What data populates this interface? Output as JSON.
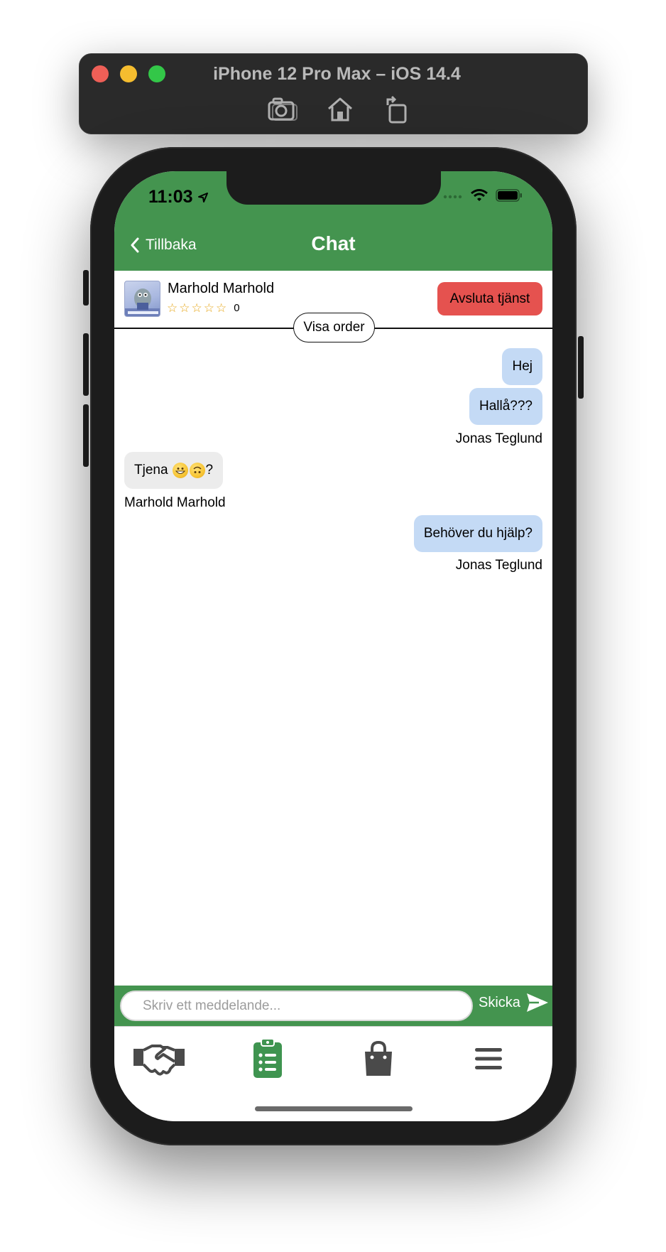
{
  "simulator": {
    "title": "iPhone 12 Pro Max – iOS 14.4",
    "tools": [
      "screenshot-icon",
      "home-icon",
      "rotate-icon"
    ]
  },
  "status_bar": {
    "time": "11:03"
  },
  "nav": {
    "back_label": "Tillbaka",
    "title": "Chat"
  },
  "user": {
    "name": "Marhold Marhold",
    "rating_stars": 0,
    "rating_count": "0",
    "end_service_label": "Avsluta tjänst",
    "view_order_label": "Visa order"
  },
  "messages": [
    {
      "text": "Hej",
      "from": "me"
    },
    {
      "text": "Hallå???",
      "from": "me",
      "sender": "Jonas Teglund"
    },
    {
      "text": "Tjena",
      "emoji": [
        "grinning-emoji",
        "upside-down-emoji"
      ],
      "suffix": "?",
      "from": "them",
      "sender": "Marhold Marhold"
    },
    {
      "text": "Behöver du hjälp?",
      "from": "me",
      "sender": "Jonas Teglund"
    }
  ],
  "composer": {
    "placeholder": "Skriv ett meddelande...",
    "send_label": "Skicka"
  },
  "tabs": [
    {
      "icon": "handshake-icon",
      "active": false
    },
    {
      "icon": "clipboard-list-icon",
      "active": true
    },
    {
      "icon": "shopping-bag-icon",
      "active": false
    },
    {
      "icon": "menu-icon",
      "active": false
    }
  ],
  "colors": {
    "header": "#44944f",
    "end_button": "#e5524f",
    "my_bubble": "#c4daf5",
    "their_bubble": "#ececec",
    "active_tab": "#3f9450",
    "inactive_tab": "#4a4a4a"
  }
}
